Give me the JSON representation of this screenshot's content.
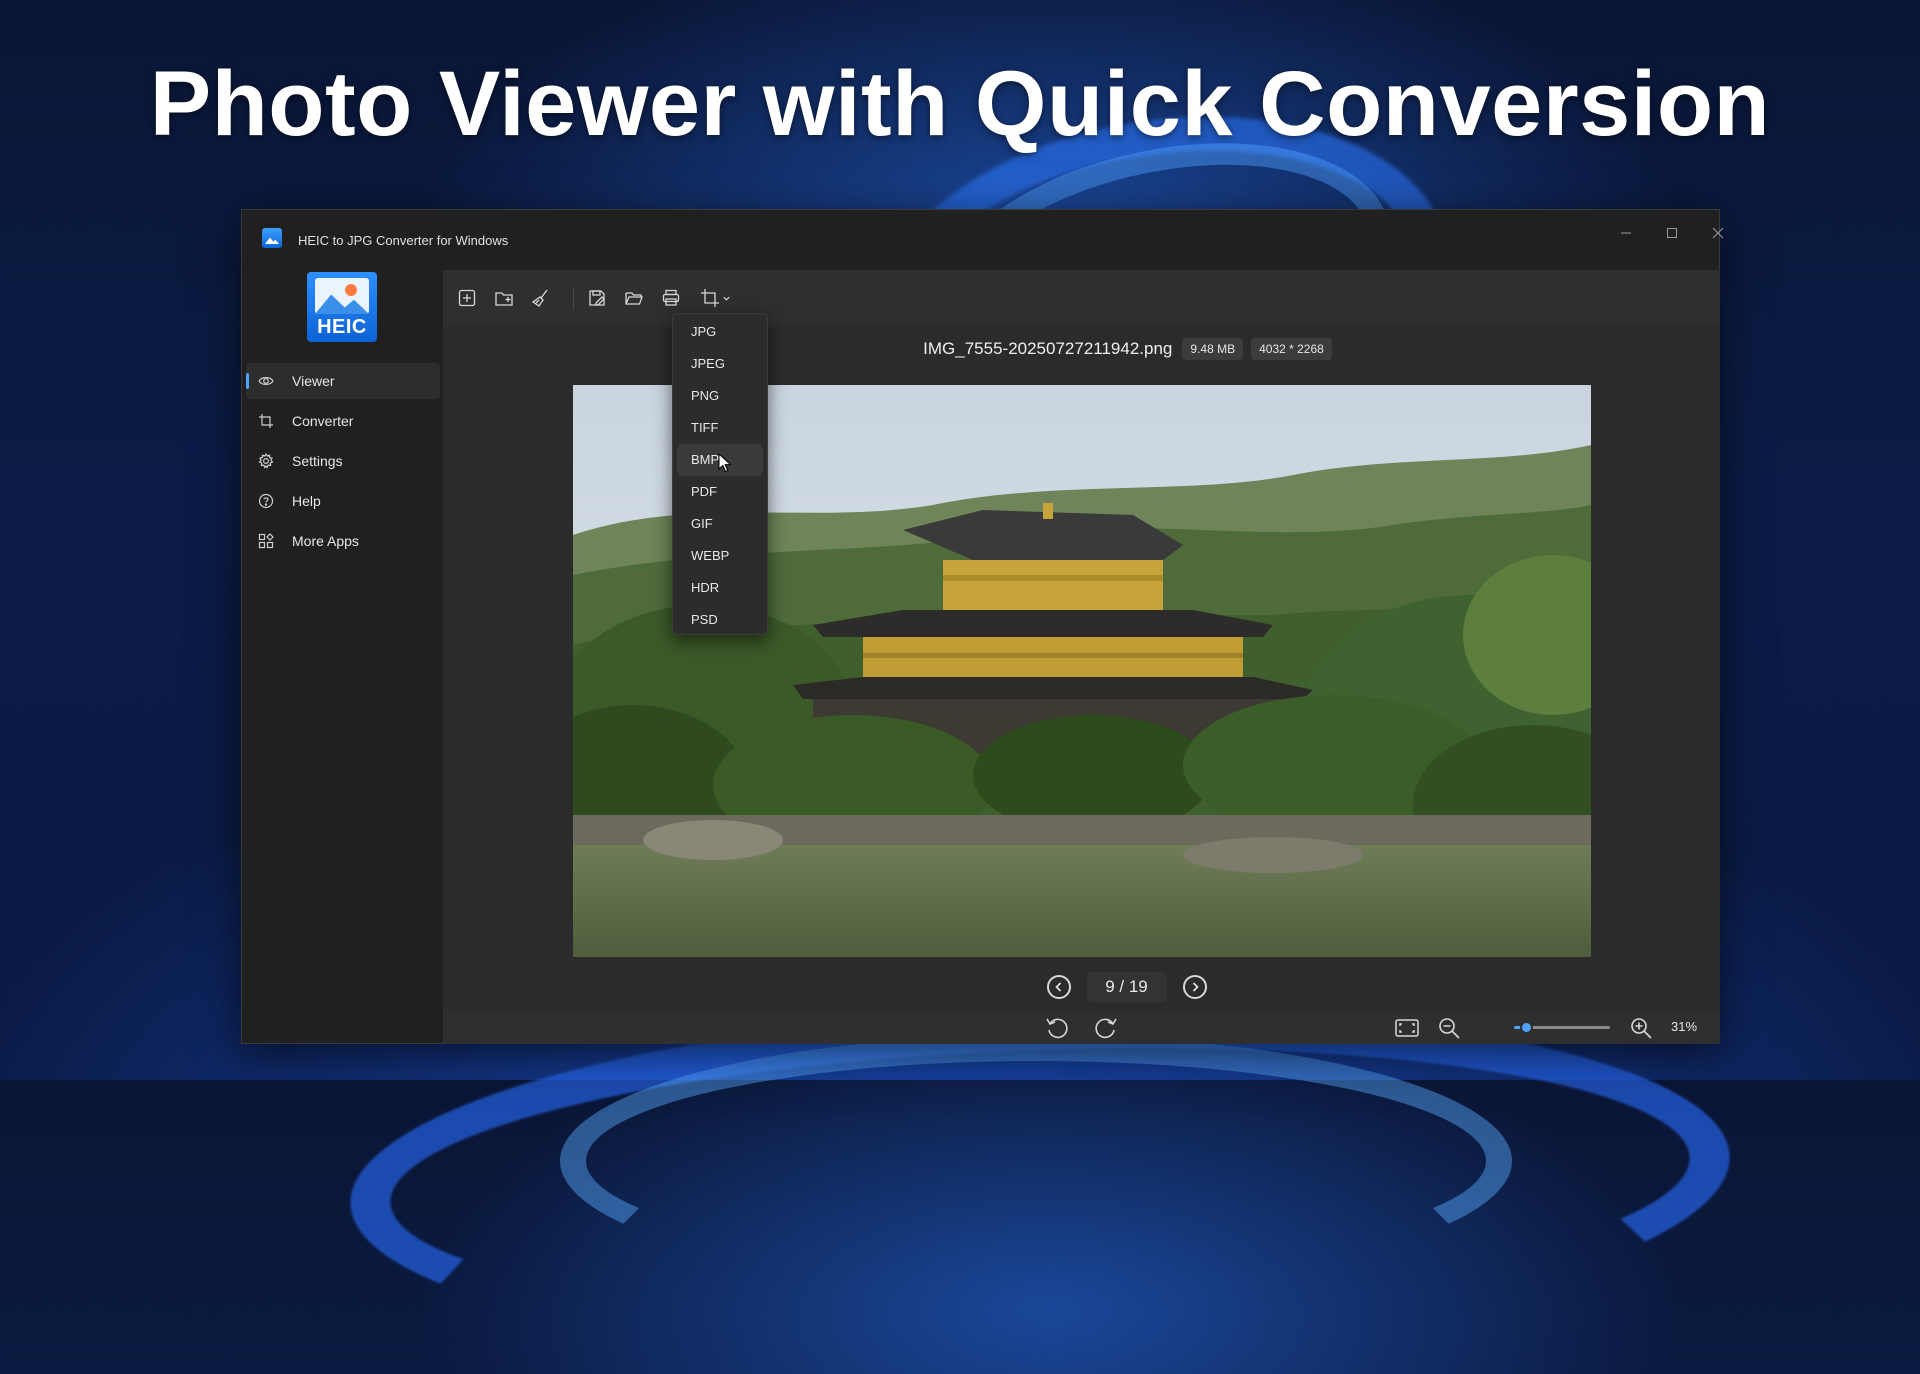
{
  "headline": "Photo Viewer with Quick Conversion",
  "window": {
    "title": "HEIC to JPG Converter for Windows",
    "logo_text": "HEIC"
  },
  "sidebar": {
    "items": [
      {
        "label": "Viewer",
        "icon": "eye-icon",
        "active": true
      },
      {
        "label": "Converter",
        "icon": "crop-icon",
        "active": false
      },
      {
        "label": "Settings",
        "icon": "gear-icon",
        "active": false
      },
      {
        "label": "Help",
        "icon": "help-icon",
        "active": false
      },
      {
        "label": "More Apps",
        "icon": "apps-icon",
        "active": false
      }
    ]
  },
  "toolbar": {
    "buttons": [
      "add-file-icon",
      "add-folder-icon",
      "clear-brush-icon",
      "save-as-icon",
      "open-folder-icon",
      "print-icon",
      "crop-convert-icon"
    ]
  },
  "file": {
    "name": "IMG_7555-20250727211942.png",
    "size": "9.48 MB",
    "dimensions": "4032 * 2268"
  },
  "pager": {
    "indicator": "9 / 19"
  },
  "zoom": {
    "percent": "31%",
    "level": 0.12
  },
  "format_menu": {
    "items": [
      "JPG",
      "JPEG",
      "PNG",
      "TIFF",
      "BMP",
      "PDF",
      "GIF",
      "WEBP",
      "HDR",
      "PSD"
    ],
    "hovered": "BMP"
  },
  "colors": {
    "accent": "#4da3ff",
    "window_bg": "#202020",
    "pane_bg": "#2b2b2b"
  }
}
